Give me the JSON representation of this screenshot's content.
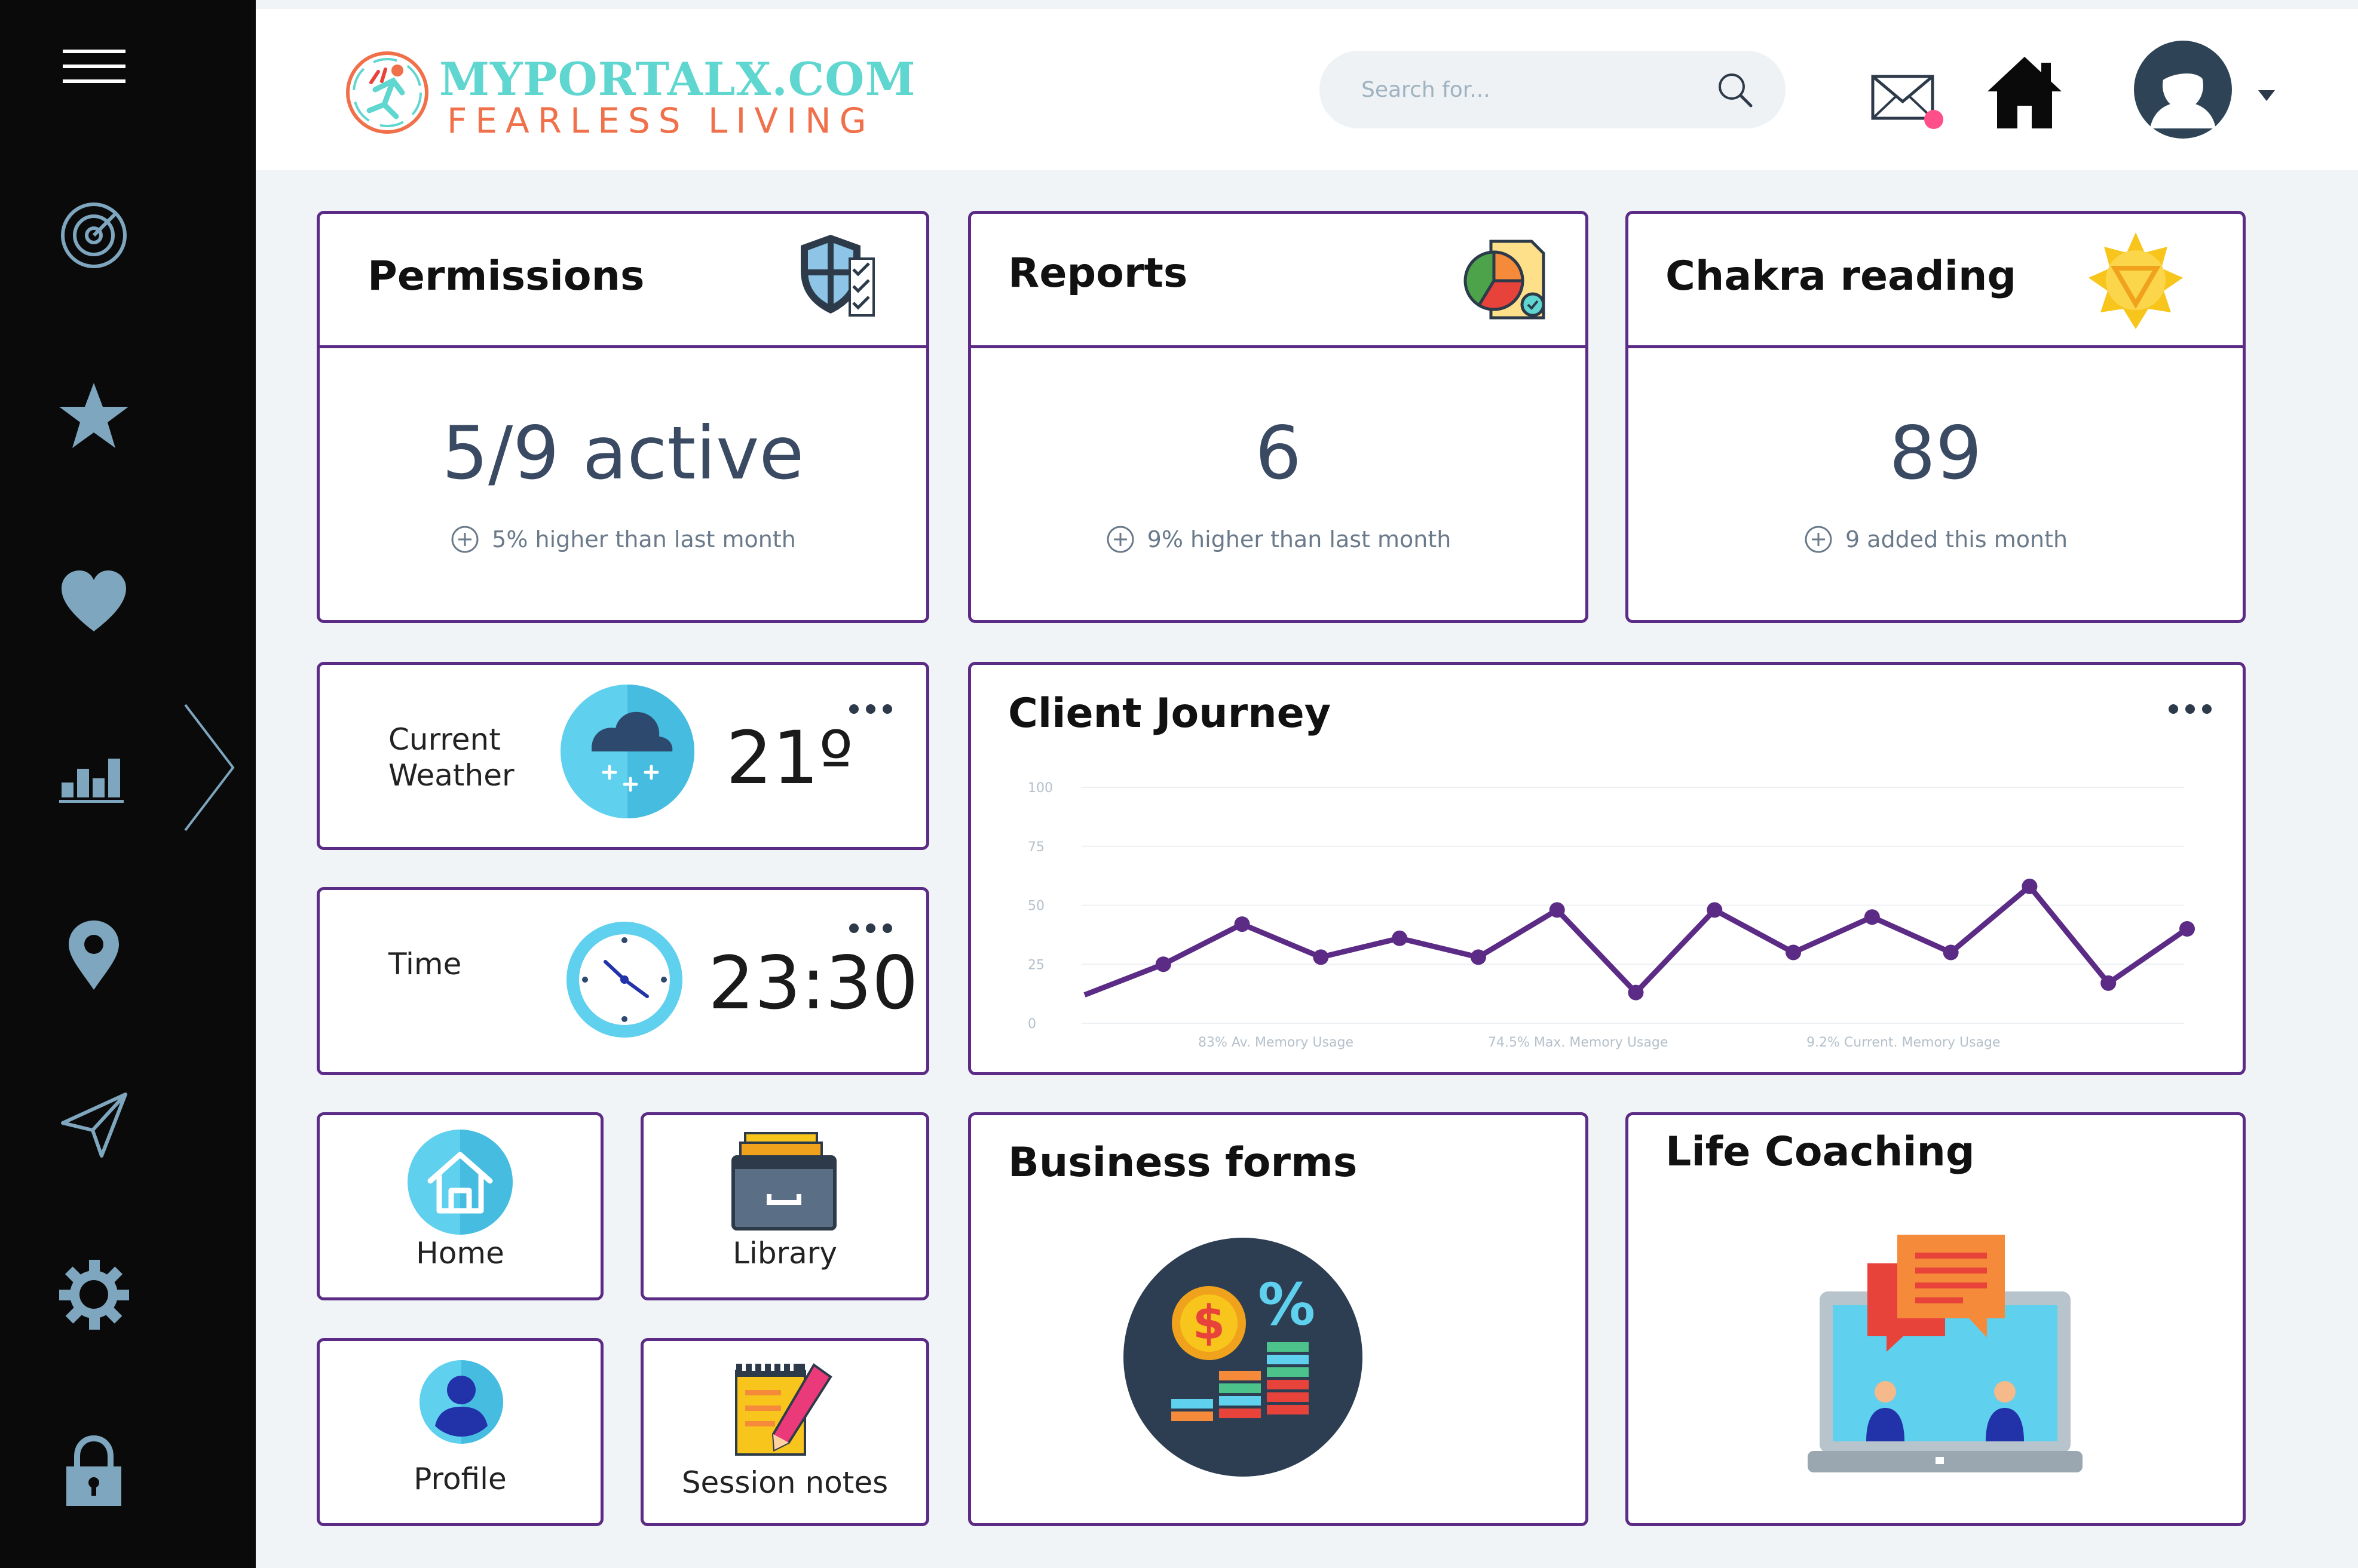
{
  "brand": {
    "title": "MYPORTALX.COM",
    "subtitle": "FEARLESS LIVING",
    "accent": "#5fd6cf",
    "accent2": "#f0704a"
  },
  "sidebar": {
    "items": [
      {
        "icon": "menu-icon"
      },
      {
        "icon": "target-icon"
      },
      {
        "icon": "star-icon"
      },
      {
        "icon": "heart-icon"
      },
      {
        "icon": "bar-chart-icon"
      },
      {
        "icon": "location-pin-icon"
      },
      {
        "icon": "send-icon"
      },
      {
        "icon": "gear-icon"
      },
      {
        "icon": "lock-icon"
      }
    ],
    "expand_icon": "chevron-right-icon",
    "icon_color": "#7fa6bf"
  },
  "header": {
    "search_placeholder": "Search for...",
    "notification_dot_color": "#ff4f8a"
  },
  "cards": {
    "permissions": {
      "title": "Permissions",
      "value": "5/9 active",
      "note": "5% higher than last month"
    },
    "reports": {
      "title": "Reports",
      "value": "6",
      "note": "9% higher than last month"
    },
    "chakra": {
      "title": "Chakra reading",
      "value": "89",
      "note": "9 added this month"
    }
  },
  "weather": {
    "label_line1": "Current",
    "label_line2": "Weather",
    "value": "21º"
  },
  "time": {
    "label": "Time",
    "value": "23:30"
  },
  "journey": {
    "title": "Client Journey",
    "legend": [
      {
        "pct": "83%",
        "label": "Av. Memory Usage"
      },
      {
        "pct": "74.5%",
        "label": "Max. Memory Usage"
      },
      {
        "pct": "9.2%",
        "label": "Current. Memory Usage"
      }
    ]
  },
  "chart_data": {
    "type": "line",
    "title": "Client Journey",
    "yticks": [
      "0",
      "25",
      "50",
      "75",
      "100"
    ],
    "ylim": [
      0,
      100
    ],
    "series": [
      {
        "values": [
          12,
          25,
          42,
          28,
          36,
          28,
          48,
          13,
          48,
          30,
          45,
          30,
          58,
          17,
          40
        ]
      }
    ],
    "line_color": "#5b2b86",
    "grid": true
  },
  "tiles": {
    "home": "Home",
    "library": "Library",
    "profile": "Profile",
    "session_notes": "Session notes"
  },
  "panels": {
    "business_forms": "Business forms",
    "life_coaching": "Life Coaching"
  }
}
